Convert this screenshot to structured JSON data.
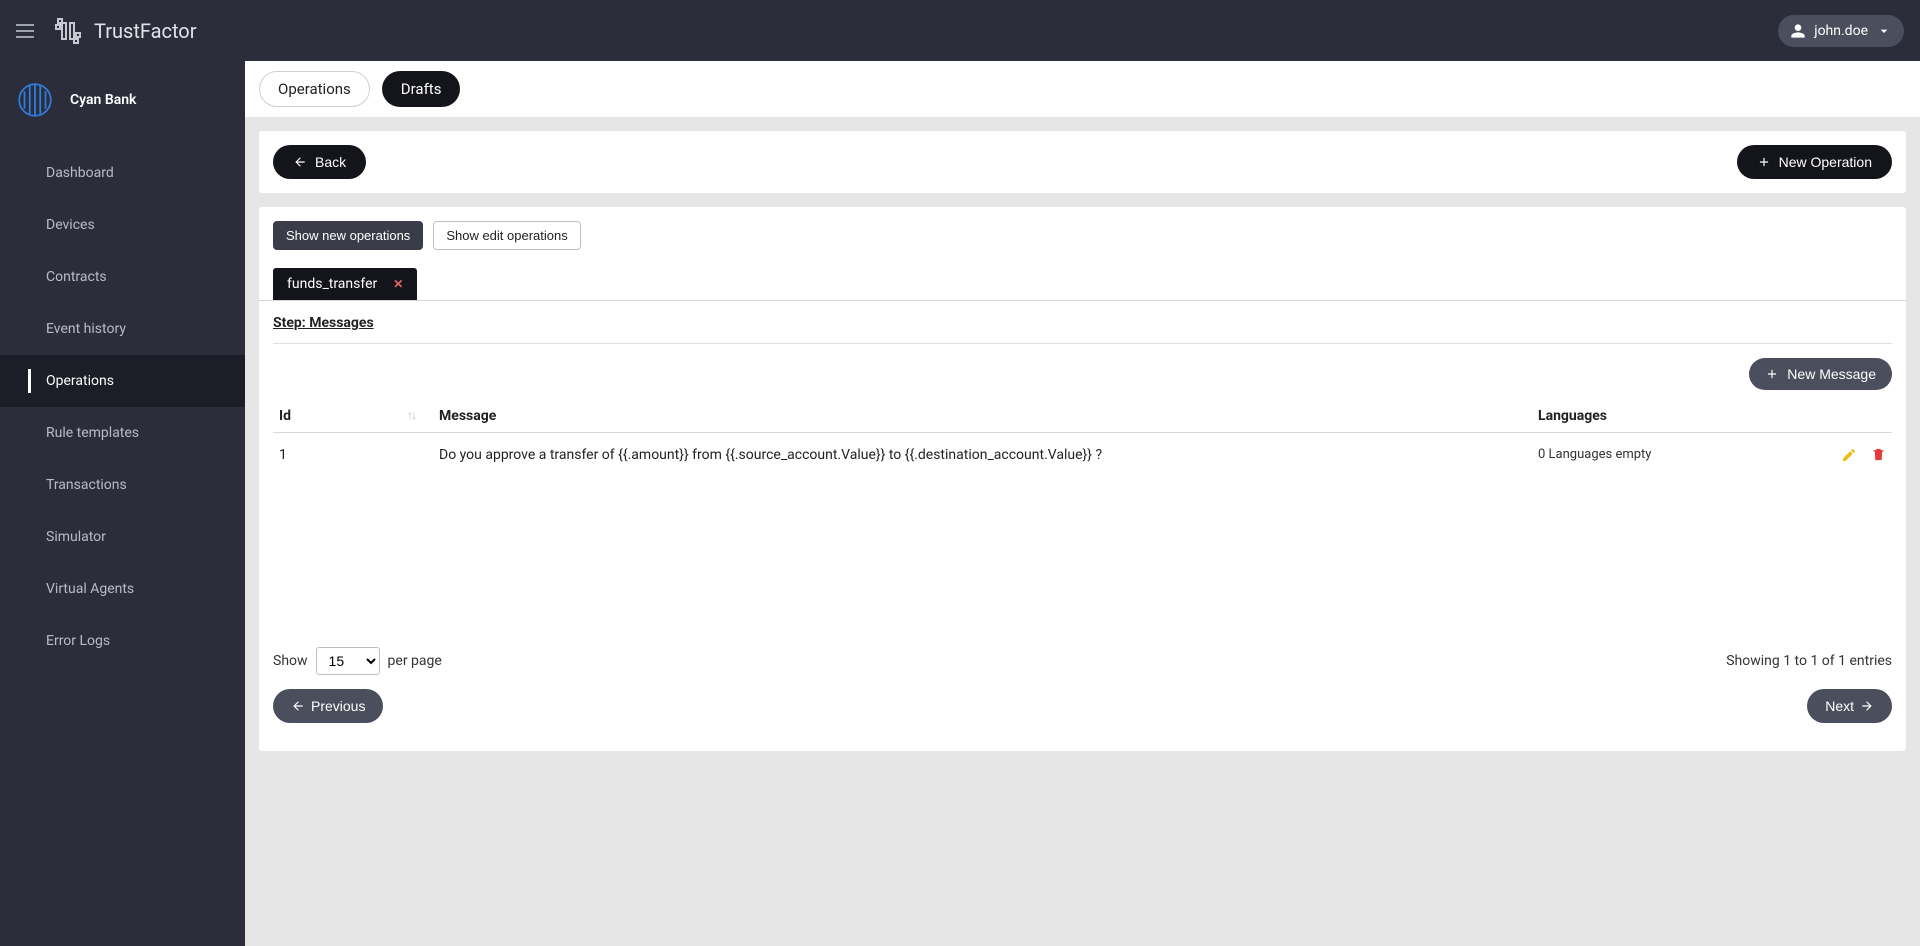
{
  "header": {
    "brand": "TrustFactor",
    "user": "john.doe"
  },
  "sidebar": {
    "org_name": "Cyan Bank",
    "items": [
      {
        "label": "Dashboard"
      },
      {
        "label": "Devices"
      },
      {
        "label": "Contracts"
      },
      {
        "label": "Event history"
      },
      {
        "label": "Operations"
      },
      {
        "label": "Rule templates"
      },
      {
        "label": "Transactions"
      },
      {
        "label": "Simulator"
      },
      {
        "label": "Virtual Agents"
      },
      {
        "label": "Error Logs"
      }
    ],
    "active_index": 4
  },
  "tabs": {
    "operations": "Operations",
    "drafts": "Drafts",
    "active": "drafts"
  },
  "actions": {
    "back": "Back",
    "new_operation": "New Operation"
  },
  "toggles": {
    "show_new": "Show new operations",
    "show_edit": "Show edit operations",
    "active": "show_new"
  },
  "file_tab": {
    "name": "funds_transfer"
  },
  "step": {
    "label": "Step: Messages",
    "new_message": "New Message"
  },
  "table": {
    "headers": {
      "id": "Id",
      "message": "Message",
      "languages": "Languages"
    },
    "rows": [
      {
        "id": "1",
        "message": "Do you approve a transfer of {{.amount}} from {{.source_account.Value}} to {{.destination_account.Value}} ?",
        "languages": "0 Languages empty"
      }
    ]
  },
  "paging": {
    "show_label": "Show",
    "per_page_label": "per page",
    "page_size": "15",
    "summary": "Showing 1 to 1 of 1 entries",
    "previous": "Previous",
    "next": "Next"
  }
}
